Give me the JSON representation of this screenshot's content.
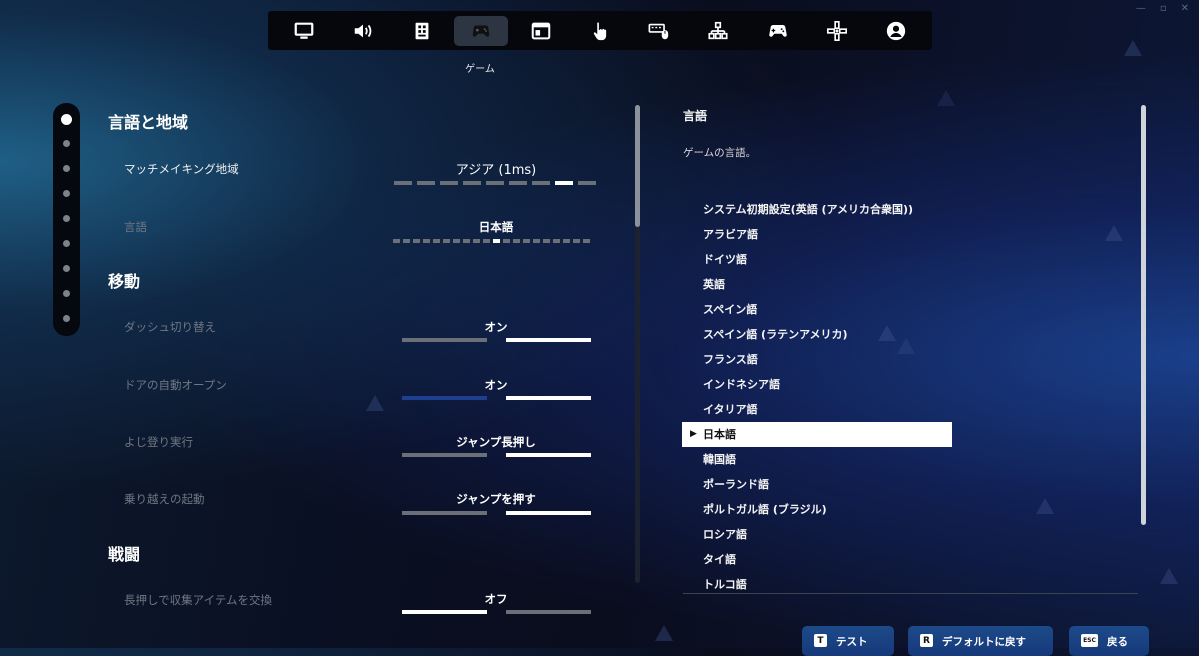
{
  "window_controls": [
    "—",
    "▫",
    "✕"
  ],
  "nav": {
    "tabs": [
      {
        "icon": "monitor-icon",
        "active": false
      },
      {
        "icon": "speaker-icon",
        "active": false
      },
      {
        "icon": "accessibility-icon",
        "active": false
      },
      {
        "icon": "game-controller-icon",
        "active": true
      },
      {
        "icon": "hud-window-icon",
        "active": false
      },
      {
        "icon": "touch-hand-icon",
        "active": false
      },
      {
        "icon": "keyboard-mouse-icon",
        "active": false
      },
      {
        "icon": "network-icon",
        "active": false
      },
      {
        "icon": "gamepad-icon",
        "active": false
      },
      {
        "icon": "dpad-icon",
        "active": false
      },
      {
        "icon": "account-icon",
        "active": false
      }
    ],
    "active_caption": "ゲーム"
  },
  "rail": {
    "dots": 9,
    "active_index": 0
  },
  "settings": {
    "section_region": "言語と地域",
    "matchmaking_label": "マッチメイキング地域",
    "matchmaking_value": "アジア (1ms)",
    "language_label": "言語",
    "language_value": "日本語",
    "section_movement": "移動",
    "dash_label": "ダッシュ切り替え",
    "dash_value": "オン",
    "door_label": "ドアの自動オープン",
    "door_value": "オン",
    "climb_label": "よじ登り実行",
    "climb_value": "ジャンプ長押し",
    "vault_label": "乗り越えの起動",
    "vault_value": "ジャンプを押す",
    "section_combat": "戦闘",
    "holdswap_label": "長押しで収集アイテムを交換",
    "holdswap_value": "オフ"
  },
  "description": {
    "title": "言語",
    "text": "ゲームの言語。"
  },
  "languages": [
    "システム初期設定(英語 (アメリカ合衆国))",
    "アラビア語",
    "ドイツ語",
    "英語",
    "スペイン語",
    "スペイン語 (ラテンアメリカ)",
    "フランス語",
    "インドネシア語",
    "イタリア語",
    "日本語",
    "韓国語",
    "ポーランド語",
    "ポルトガル語 (ブラジル)",
    "ロシア語",
    "タイ語",
    "トルコ語"
  ],
  "selected_language_index": 9,
  "buttons": {
    "test_key": "T",
    "test_label": "テスト",
    "default_key": "R",
    "default_label": "デフォルトに戻す",
    "back_key": "ESC",
    "back_label": "戻る"
  },
  "colors": {
    "accent_blue": "#1d4a8a",
    "toggle_off": "#6a6f78",
    "toggle_on": "#ffffff"
  }
}
